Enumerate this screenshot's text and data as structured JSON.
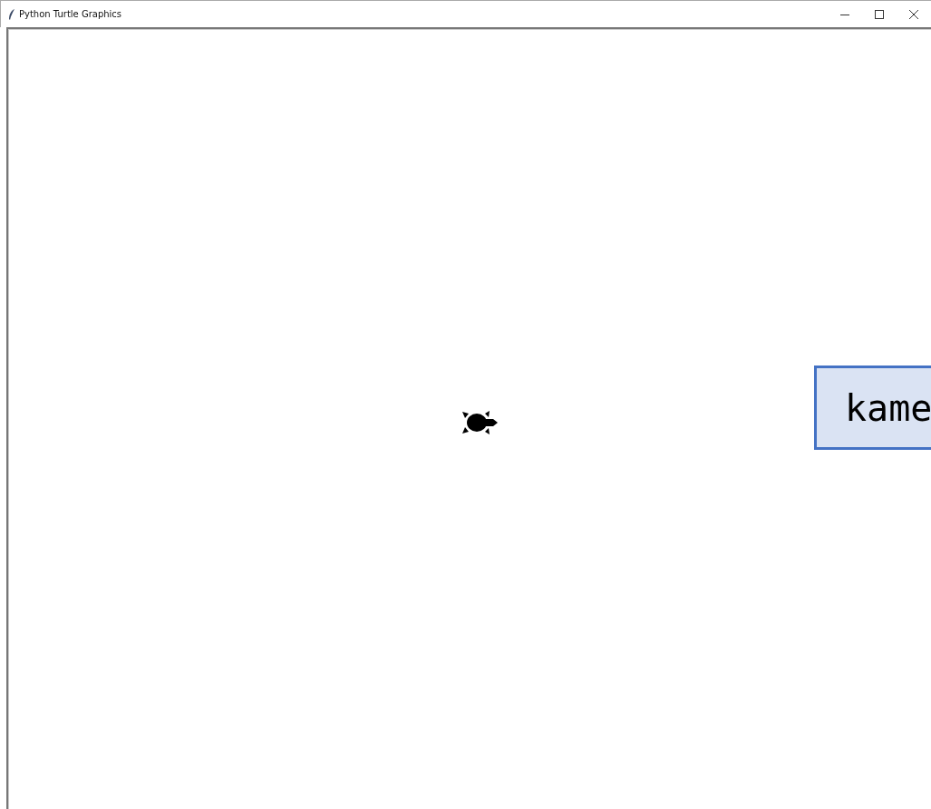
{
  "window": {
    "title": "Python Turtle Graphics"
  },
  "canvas": {
    "label": {
      "text": "kame"
    }
  }
}
